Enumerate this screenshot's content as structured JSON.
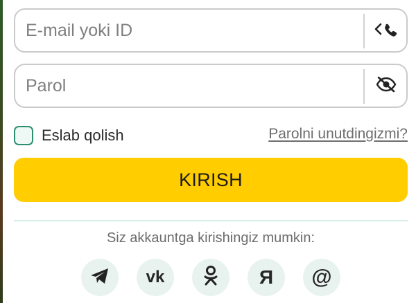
{
  "login_form": {
    "email_field": {
      "placeholder": "E-mail yoki ID",
      "value": "",
      "toggle_icon": "chevron-left-phone-icon"
    },
    "password_field": {
      "placeholder": "Parol",
      "value": "",
      "toggle_icon": "eye-slash-icon"
    },
    "remember_label": "Eslab qolish",
    "remember_checked": false,
    "forgot_link": "Parolni unutdingizmi?",
    "submit_label": "KIRISH"
  },
  "social": {
    "title": "Siz akkauntga kirishingiz mumkin:",
    "providers": [
      {
        "icon": "telegram-icon"
      },
      {
        "icon": "vk-icon",
        "glyph": "vk"
      },
      {
        "icon": "odnoklassniki-icon"
      },
      {
        "icon": "yandex-icon",
        "glyph": "Я"
      },
      {
        "icon": "email-at-icon",
        "glyph": "@"
      }
    ]
  },
  "colors": {
    "accent_yellow": "#ffcd00",
    "checkbox_border": "#2c8f72",
    "social_bg": "#e8f3ef",
    "field_border": "#c9cbc9"
  }
}
